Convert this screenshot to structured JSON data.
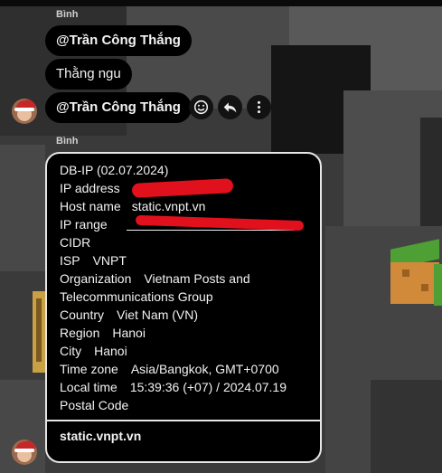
{
  "colors": {
    "bubble_bg": "#000000",
    "text": "#f2f2f2",
    "redaction": "#e0101c",
    "card_border": "#e6e6e6"
  },
  "messages": {
    "top_sender": "Bình",
    "bubble1": "@Trần Công Thắng",
    "bubble2": "Thằng ngu",
    "bubble3": "@Trần Công Thắng",
    "second_sender": "Bình"
  },
  "actions": {
    "react_icon": "smile-icon",
    "reply_icon": "reply-icon",
    "more_icon": "more-vertical-icon"
  },
  "ip_card": {
    "title": "DB-IP (02.07.2024)",
    "ip_address_label": "IP address",
    "host_name_label": "Host name",
    "host_name_value": "static.vnpt.vn",
    "ip_range_label": "IP range",
    "cidr_label": "CIDR",
    "isp_label": "ISP",
    "isp_value": "VNPT",
    "organization_label": "Organization",
    "organization_value": "Vietnam Posts and",
    "organization_value_cont": "Telecommunications Group",
    "country_label": "Country",
    "country_value": "Viet Nam (VN)",
    "region_label": "Region",
    "region_value": "Hanoi",
    "city_label": "City",
    "city_value": "Hanoi",
    "time_zone_label": "Time zone",
    "time_zone_value": "Asia/Bangkok, GMT+0700",
    "local_time_label": "Local time",
    "local_time_value": "15:39:36 (+07) / 2024.07.19",
    "postal_code_label": "Postal Code",
    "footer_link": "static.vnpt.vn"
  }
}
